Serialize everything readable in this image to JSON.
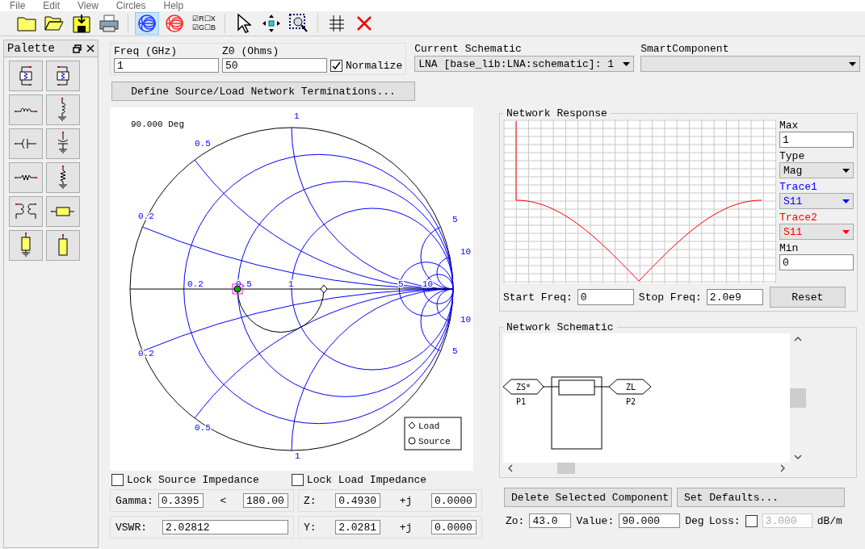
{
  "menu": [
    "File",
    "Edit",
    "View",
    "Circles",
    "Help"
  ],
  "toolbar": [
    {
      "kind": "folder",
      "selected": false
    },
    {
      "kind": "open_folder",
      "selected": false
    },
    {
      "kind": "save",
      "selected": false
    },
    {
      "kind": "print",
      "selected": false
    },
    {
      "kind": "smith_blue",
      "selected": true
    },
    {
      "kind": "smith_red",
      "selected": false
    },
    {
      "kind": "toggles",
      "lines": [
        "☑R☐X",
        "☑G☐B"
      ],
      "selected": false
    },
    {
      "kind": "pointer",
      "selected": false
    },
    {
      "kind": "move",
      "selected": false
    },
    {
      "kind": "zoom",
      "selected": false
    },
    {
      "kind": "grid",
      "selected": false
    },
    {
      "kind": "delete",
      "selected": false
    }
  ],
  "palette": {
    "title": "Palette",
    "items": [
      {
        "kind": "block_series"
      },
      {
        "kind": "block_shunt"
      },
      {
        "kind": "coil_series"
      },
      {
        "kind": "coil_shunt"
      },
      {
        "kind": "cap_series"
      },
      {
        "kind": "cap_shunt"
      },
      {
        "kind": "res_series"
      },
      {
        "kind": "res_shunt"
      },
      {
        "kind": "transformer"
      },
      {
        "kind": "line_series"
      },
      {
        "kind": "stub_ground"
      },
      {
        "kind": "stub_open"
      }
    ]
  },
  "freq": {
    "label": "Freq (GHz)",
    "value": "1"
  },
  "z0": {
    "label": "Z0 (Ohms)",
    "value": "50"
  },
  "normalize": {
    "label": "Normalize",
    "checked": true
  },
  "current_schematic": {
    "label": "Current Schematic",
    "value": "LNA [base_lib:LNA:schematic]: 1"
  },
  "smart_component": {
    "label": "SmartComponent"
  },
  "define_button": "Define Source/Load Network Terminations...",
  "smith": {
    "angle": "90.000 Deg",
    "labels": [
      "1",
      "0.5",
      "0.2",
      "0.2",
      "0.5",
      "1",
      "5",
      "10",
      "0.2",
      "0.5",
      "1",
      "5",
      "10",
      "10",
      "5"
    ],
    "legend": [
      {
        "kind": "load",
        "label": "Load"
      },
      {
        "kind": "source",
        "label": "Source"
      }
    ]
  },
  "lock_source": {
    "label": "Lock Source Impedance",
    "checked": false
  },
  "lock_load": {
    "label": "Lock Load Impedance",
    "checked": false
  },
  "gamma": {
    "label": "Gamma:",
    "mag": "0.3395",
    "sep": "<",
    "angle": "180.00"
  },
  "z": {
    "label": "Z:",
    "re": "0.4930",
    "j": "+j",
    "im": "0.0000"
  },
  "vswr": {
    "label": "VSWR:",
    "value": "2.02812"
  },
  "y": {
    "label": "Y:",
    "re": "2.0281",
    "j": "+j",
    "im": "0.0000"
  },
  "response": {
    "title": "Network Response",
    "max_label": "Max",
    "max": "1",
    "type_label": "Type",
    "type": "Mag",
    "traces": [
      {
        "label": "Trace1",
        "value": "S11",
        "color": "#0000ff"
      },
      {
        "label": "Trace2",
        "value": "S11",
        "color": "#ff0000"
      }
    ],
    "min_label": "Min",
    "min": "0",
    "start_label": "Start Freq:",
    "start": "0",
    "stop_label": "Stop Freq:",
    "stop": "2.0e9",
    "reset": "Reset"
  },
  "schematic": {
    "title": "Network Schematic",
    "source_port": "ZS*",
    "source_name": "P1",
    "load_port": "ZL",
    "load_name": "P2"
  },
  "delete_button": "Delete Selected Component",
  "defaults_button": "Set Defaults...",
  "zo": {
    "label": "Zo:",
    "value": "43.0"
  },
  "value": {
    "label": "Value:",
    "value": "90.000",
    "unit": "Deg"
  },
  "loss": {
    "label": "Loss:",
    "checked": false,
    "value": "3.000",
    "disabled": true,
    "unit": "dB/m"
  }
}
